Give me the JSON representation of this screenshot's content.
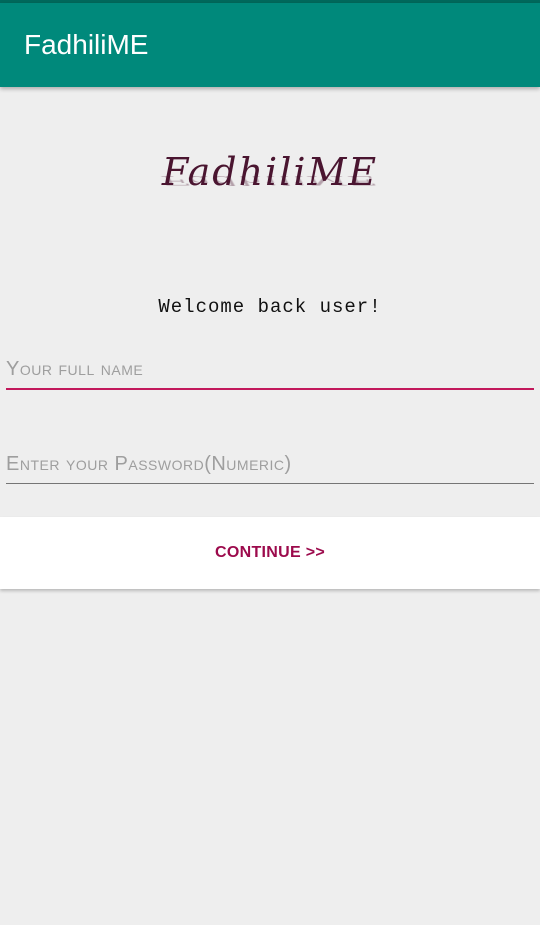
{
  "app_bar": {
    "title": "FadhiliME"
  },
  "logo": {
    "text": "FadhiliME",
    "color": "#4a1530"
  },
  "welcome": {
    "text": "Welcome back user!"
  },
  "form": {
    "name_placeholder": "Your full name",
    "password_placeholder": "Enter your Password(Numeric)"
  },
  "actions": {
    "continue_label": "CONTINUE >>"
  },
  "colors": {
    "app_bar": "#00897b",
    "status_strip": "#00695c",
    "accent": "#c2185b",
    "button_text": "#9c0a4c",
    "background": "#eeeeee"
  }
}
